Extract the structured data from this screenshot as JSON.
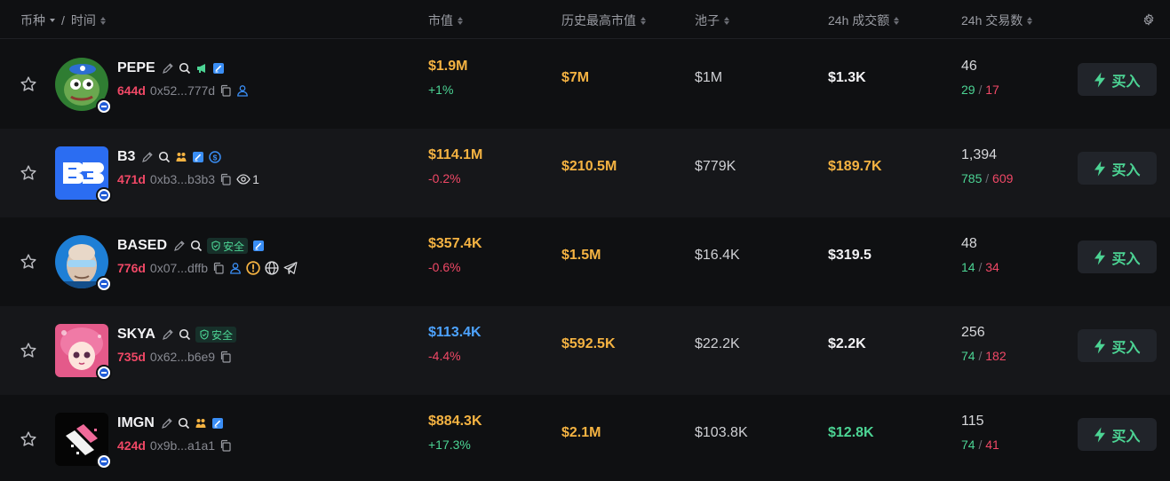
{
  "header": {
    "col_token": "币种",
    "col_sep": "/",
    "col_time": "时间",
    "col_mcap": "市值",
    "col_ath": "历史最高市值",
    "col_pool": "池子",
    "col_vol": "24h 成交额",
    "col_txs": "24h 交易数",
    "settings_icon": "gear-icon"
  },
  "colors": {
    "age": "#f04866",
    "up": "#4cd494",
    "down": "#f04866",
    "ath": "#f5b342",
    "mcap_gold": "#f5b342",
    "mcap_blue": "#4da3ff",
    "accent_bg": "#21242a"
  },
  "rows": [
    {
      "symbol": "PEPE",
      "age": "644d",
      "address": "0x52...777d",
      "mcap": "$1.9M",
      "change": "+1%",
      "ath": "$7M",
      "pool": "$1M",
      "volume": "$1.3K",
      "txs": "46",
      "buys": "29",
      "sells": "17",
      "buy_label": "买入"
    },
    {
      "symbol": "B3",
      "age": "471d",
      "address": "0xb3...b3b3",
      "watchers": "1",
      "mcap": "$114.1M",
      "change": "-0.2%",
      "ath": "$210.5M",
      "pool": "$779K",
      "volume": "$189.7K",
      "txs": "1,394",
      "buys": "785",
      "sells": "609",
      "buy_label": "买入"
    },
    {
      "symbol": "BASED",
      "age": "776d",
      "address": "0x07...dffb",
      "safe_label": "安全",
      "mcap": "$357.4K",
      "change": "-0.6%",
      "ath": "$1.5M",
      "pool": "$16.4K",
      "volume": "$319.5",
      "txs": "48",
      "buys": "14",
      "sells": "34",
      "buy_label": "买入"
    },
    {
      "symbol": "SKYA",
      "age": "735d",
      "address": "0x62...b6e9",
      "safe_label": "安全",
      "mcap": "$113.4K",
      "change": "-4.4%",
      "ath": "$592.5K",
      "pool": "$22.2K",
      "volume": "$2.2K",
      "txs": "256",
      "buys": "74",
      "sells": "182",
      "buy_label": "买入"
    },
    {
      "symbol": "IMGN",
      "age": "424d",
      "address": "0x9b...a1a1",
      "mcap": "$884.3K",
      "change": "+17.3%",
      "ath": "$2.1M",
      "pool": "$103.8K",
      "volume": "$12.8K",
      "txs": "115",
      "buys": "74",
      "sells": "41",
      "buy_label": "买入"
    }
  ]
}
